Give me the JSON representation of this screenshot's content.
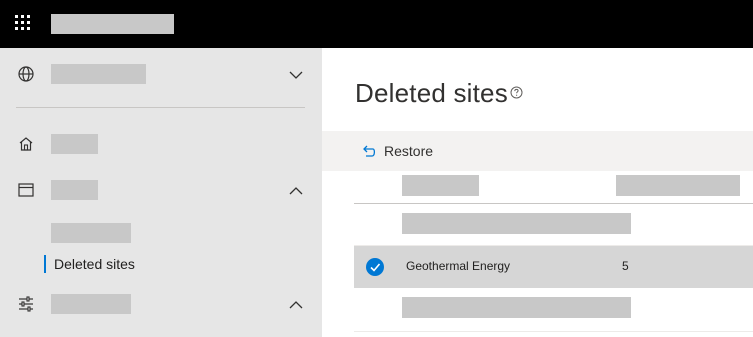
{
  "topbar": {
    "app_launcher_icon": "waffle-icon",
    "app_title": ""
  },
  "sidebar": {
    "items": [
      {
        "icon": "globe-icon",
        "label": "",
        "chevron": "chevron-down-icon"
      },
      {
        "icon": "home-icon",
        "label": ""
      },
      {
        "icon": "window-icon",
        "label": "",
        "chevron": "chevron-up-icon"
      },
      {
        "icon": "",
        "label": ""
      },
      {
        "icon": "",
        "label": "Deleted sites",
        "active": true
      },
      {
        "icon": "settings-sliders-icon",
        "label": "",
        "chevron": "chevron-up-icon"
      }
    ]
  },
  "main": {
    "title": "Deleted sites",
    "help_icon": "help-circle-icon",
    "command_bar": {
      "restore_label": "Restore",
      "restore_icon": "undo-icon"
    },
    "table": {
      "rows": [
        {
          "name": "",
          "count": "",
          "selected": false
        },
        {
          "name": "Geothermal Energy",
          "count": "5",
          "selected": true
        },
        {
          "name": "",
          "count": "",
          "selected": false
        }
      ]
    }
  },
  "colors": {
    "accent": "#0078d4",
    "topbar": "#000000",
    "sidebar_bg": "#e6e6e6",
    "selected_row": "#d6d6d6",
    "redaction": "#c8c8c8"
  }
}
